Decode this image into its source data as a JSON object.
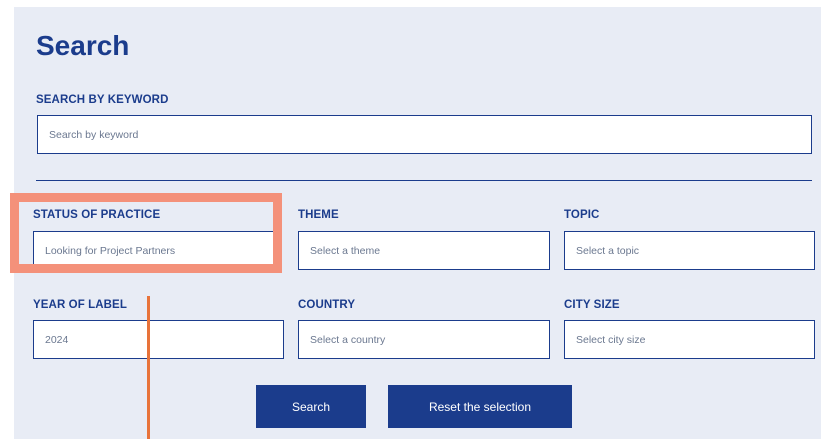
{
  "search": {
    "title": "Search",
    "keyword_label": "SEARCH BY KEYWORD",
    "keyword_placeholder": "Search by keyword"
  },
  "filters": {
    "status": {
      "label": "STATUS OF PRACTICE",
      "value": "Looking for Project Partners"
    },
    "theme": {
      "label": "THEME",
      "value": "Select a theme"
    },
    "topic": {
      "label": "TOPIC",
      "value": "Select a topic"
    },
    "year": {
      "label": "YEAR OF LABEL",
      "value": "2024"
    },
    "country": {
      "label": "COUNTRY",
      "value": "Select a country"
    },
    "city_size": {
      "label": "CITY SIZE",
      "value": "Select city size"
    }
  },
  "buttons": {
    "search": "Search",
    "reset": "Reset the selection"
  },
  "annotation": {
    "highlight_color": "#f4917a",
    "pointer_color": "#e8733a"
  }
}
